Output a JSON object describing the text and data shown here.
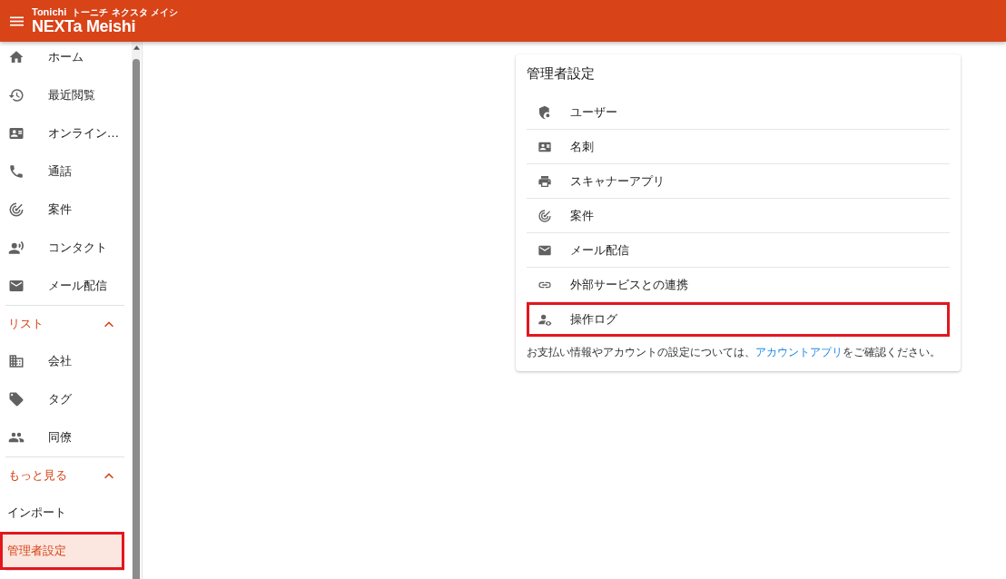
{
  "header": {
    "logo": {
      "brand_top": "Tonichi",
      "brand_reading": "トーニチ ネクスタ メイシ",
      "brand_main": "NEXTa Meishi"
    }
  },
  "sidebar": {
    "items": [
      {
        "label": "ホーム",
        "selected": false,
        "highlighted": false
      },
      {
        "label": "最近閲覧",
        "selected": false,
        "highlighted": false
      },
      {
        "label": "オンライン…",
        "selected": false,
        "highlighted": false
      },
      {
        "label": "通話",
        "selected": false,
        "highlighted": false
      },
      {
        "label": "案件",
        "selected": false,
        "highlighted": false
      },
      {
        "label": "コンタクト",
        "selected": false,
        "highlighted": false
      },
      {
        "label": "メール配信",
        "selected": false,
        "highlighted": false
      }
    ],
    "sections": [
      {
        "title": "リスト",
        "expanded": true,
        "items": [
          {
            "label": "会社",
            "selected": false,
            "highlighted": false
          },
          {
            "label": "タグ",
            "selected": false,
            "highlighted": false
          },
          {
            "label": "同僚",
            "selected": false,
            "highlighted": false
          }
        ]
      },
      {
        "title": "もっと見る",
        "expanded": true,
        "items": [
          {
            "label": "インポート",
            "selected": false,
            "highlighted": false
          },
          {
            "label": "管理者設定",
            "selected": true,
            "highlighted": true
          }
        ]
      }
    ]
  },
  "admin_card": {
    "title": "管理者設定",
    "items": [
      {
        "label": "ユーザー",
        "highlighted": false
      },
      {
        "label": "名刺",
        "highlighted": false
      },
      {
        "label": "スキャナーアプリ",
        "highlighted": false
      },
      {
        "label": "案件",
        "highlighted": false
      },
      {
        "label": "メール配信",
        "highlighted": false
      },
      {
        "label": "外部サービスとの連携",
        "highlighted": false
      },
      {
        "label": "操作ログ",
        "highlighted": true
      }
    ],
    "note": {
      "before": "お支払い情報やアカウントの設定については、",
      "link": "アカウントアプリ",
      "after": "をご確認ください。"
    }
  }
}
